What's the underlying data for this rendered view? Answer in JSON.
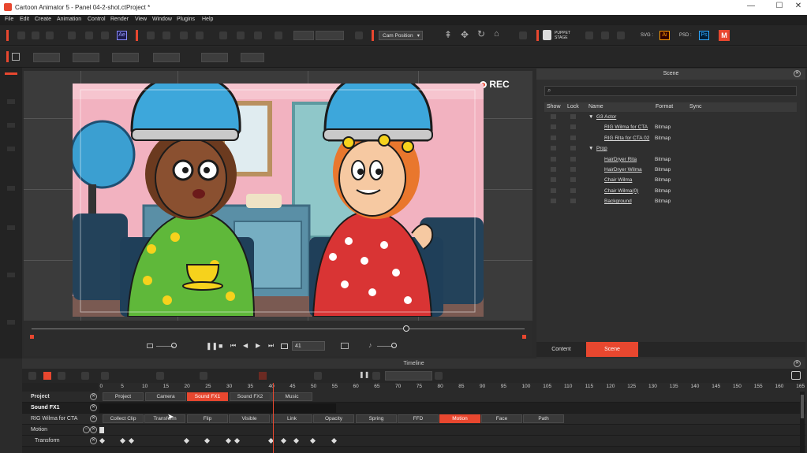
{
  "window": {
    "title": "Cartoon Animator 5 - Panel 04-2-shot.ctProject *",
    "controls": [
      "—",
      "☐",
      "✕"
    ]
  },
  "menu": [
    "File",
    "Edit",
    "Create",
    "Animation",
    "Control",
    "Render",
    "View",
    "Window",
    "Plugins",
    "Help"
  ],
  "toolbar": {
    "cam_position": "Cam Position",
    "puppet_stage": "PUPPET\nSTAGE",
    "svg_label": "SVG :",
    "psd_label": "PSD :",
    "ae_label": "Ae",
    "ai_label": "Ai",
    "ps_label": "Ps",
    "m_label": "M"
  },
  "viewport": {
    "rec_label": "REC",
    "frame_value": "41"
  },
  "scene_panel": {
    "title": "Scene",
    "columns": [
      "Show",
      "Lock",
      "Name",
      "Format",
      "Sync"
    ],
    "rows": [
      {
        "name": "G3 Actor",
        "format": "",
        "indent": 0,
        "group": true
      },
      {
        "name": "RIG Wilma for CTA",
        "format": "Bitmap",
        "indent": 1,
        "group": false
      },
      {
        "name": "RIG Rita for CTA 02",
        "format": "Bitmap",
        "indent": 1,
        "group": false
      },
      {
        "name": "Prop",
        "format": "",
        "indent": 0,
        "group": true
      },
      {
        "name": "HairDryer Rita",
        "format": "Bitmap",
        "indent": 1,
        "group": false
      },
      {
        "name": "HairDryer Wilma",
        "format": "Bitmap",
        "indent": 1,
        "group": false
      },
      {
        "name": "Chair Wilma",
        "format": "Bitmap",
        "indent": 1,
        "group": false
      },
      {
        "name": "Chair Wilma(0)",
        "format": "Bitmap",
        "indent": 1,
        "group": false
      },
      {
        "name": "Background",
        "format": "Bitmap",
        "indent": 1,
        "group": false
      }
    ],
    "tabs": [
      {
        "label": "Content",
        "active": false
      },
      {
        "label": "Scene",
        "active": true
      }
    ]
  },
  "timeline": {
    "title": "Timeline",
    "ticks": [
      "0",
      "5",
      "10",
      "15",
      "20",
      "25",
      "30",
      "35",
      "40",
      "45",
      "50",
      "55",
      "60",
      "65",
      "70",
      "75",
      "80",
      "85",
      "90",
      "95",
      "100",
      "105",
      "110",
      "115",
      "120",
      "125",
      "130",
      "135",
      "140",
      "145",
      "150",
      "155",
      "160",
      "165"
    ],
    "playhead_frame": 41,
    "track_buttons": [
      {
        "label": "Project",
        "active": false
      },
      {
        "label": "Camera",
        "active": false
      },
      {
        "label": "Sound FX1",
        "active": true
      },
      {
        "label": "Sound FX2",
        "active": false
      },
      {
        "label": "Music",
        "active": false
      }
    ],
    "rig_buttons": [
      {
        "label": "Collect Clip",
        "active": false
      },
      {
        "label": "Transform",
        "active": false
      },
      {
        "label": "Flip",
        "active": false
      },
      {
        "label": "Visible",
        "active": false
      },
      {
        "label": "Link",
        "active": false
      },
      {
        "label": "Opacity",
        "active": false
      },
      {
        "label": "Spring",
        "active": false
      },
      {
        "label": "FFD",
        "active": false
      },
      {
        "label": "Motion",
        "active": true
      },
      {
        "label": "Face",
        "active": false
      },
      {
        "label": "Path",
        "active": false
      }
    ],
    "tracks": [
      "Project",
      "Sound FX1",
      "RIG Wilma for CTA",
      "Motion",
      "Transform"
    ],
    "transform_keys": [
      0,
      5,
      7,
      20,
      25,
      30,
      32,
      40,
      43,
      46,
      50,
      55
    ]
  }
}
